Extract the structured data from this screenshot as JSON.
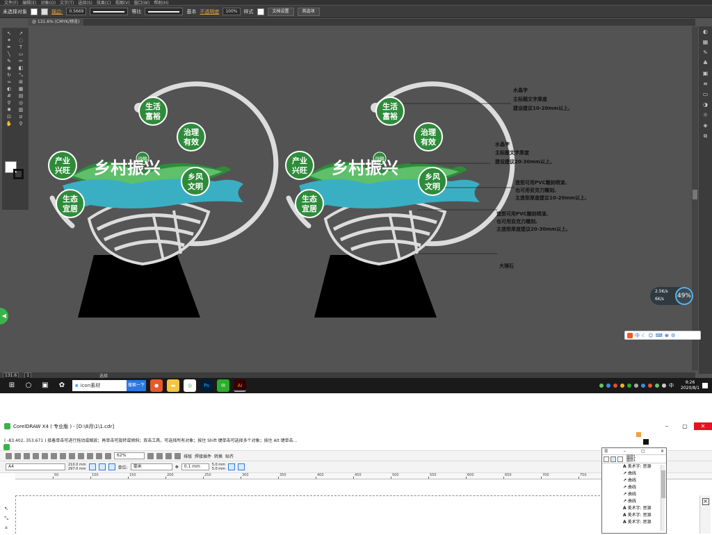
{
  "illustrator": {
    "menu": [
      "文件(F)",
      "编辑(E)",
      "对象(O)",
      "文字(T)",
      "选择(S)",
      "效果(C)",
      "视图(V)",
      "窗口(W)",
      "帮助(H)"
    ],
    "control": {
      "no_selection": "未选择对象",
      "stroke_label": "描边:",
      "stroke_width": "0.5669",
      "profile_uniform": "等比",
      "brush_basic": "基本",
      "opacity_label": "不透明度",
      "opacity_value": "100%",
      "style_label": "样式",
      "doc_setup": "文档设置",
      "preferences": "首选项"
    },
    "tab": "@ 131.6% (CMYK/预览)",
    "status": {
      "zoom": "131.6",
      "page": "1",
      "tool": "选择"
    },
    "network": {
      "up": "2.5K/s",
      "down": "6K/s",
      "percent": "49%"
    },
    "ime_label": "中"
  },
  "artwork": {
    "main_title": "乡村振兴",
    "badge_small": "战略",
    "badges": [
      "生活富裕",
      "治理有效",
      "产业兴旺",
      "乡风文明",
      "生态宜居"
    ],
    "annotations": [
      [
        "水晶字",
        "主标题文字厚度",
        "建设建议10-20mm以上,"
      ],
      [
        "水晶字",
        "主标题文字厚度",
        "建设建议20-30mm以上,"
      ],
      [
        "造型可用PVC雕刻喷漆,",
        "也可用亚克力雕刻,",
        "主造型厚度建议10-20mm以上,"
      ],
      [
        "造型可用PVC雕刻喷漆,",
        "也可用亚克力雕刻,",
        "主造型厚度建议20-30mm以上,"
      ],
      [
        "大理石"
      ]
    ],
    "colors": {
      "teal": "#3aafc4",
      "green": "#2e8b3a",
      "leaf": "#5fbf6a",
      "stone": "#000000",
      "ring": "#dcdcdc"
    }
  },
  "taskbar": {
    "search_text": "icon素材",
    "search_button": "搜索一下",
    "apps": [
      "Ps",
      "Ai"
    ],
    "time": "9:26",
    "date": "2020/8/1",
    "lang": "中"
  },
  "coreldraw": {
    "title": "CorelDRAW X4 ( 专业版 ) - [D:\\8月\\1\\1.cdr]",
    "hint": "( -83.402, 353.671 )    接着单击可进行拖动或缩放；再单击可旋转或倾斜；双击工具，可选择所有对象；按住 Shift 键单击可选择多个对象；按住 Alt 键单击...",
    "zoom": "62%",
    "toolbar_labels": [
      "排版",
      "焊接插件",
      "转换",
      "贴齐"
    ],
    "page_size": "A4",
    "width": "210.0 mm",
    "height": "297.0 mm",
    "units_label": "单位:",
    "units": "毫米",
    "nudge": "0.1 mm",
    "dup_x": "5.0 mm",
    "dup_y": "5.0 mm",
    "ruler_ticks": [
      "50",
      "100",
      "150",
      "200",
      "250",
      "300",
      "350",
      "400",
      "450",
      "500",
      "550",
      "600",
      "650",
      "700",
      "750",
      "800"
    ],
    "objmgr": {
      "layers": [
        "图层1",
        "图层1"
      ],
      "items": [
        {
          "icon": "A",
          "label": "美术字: 思源"
        },
        {
          "icon": "↗",
          "label": "曲线"
        },
        {
          "icon": "↗",
          "label": "曲线"
        },
        {
          "icon": "↗",
          "label": "曲线"
        },
        {
          "icon": "↗",
          "label": "曲线"
        },
        {
          "icon": "↗",
          "label": "曲线"
        },
        {
          "icon": "A",
          "label": "美术字: 思源"
        },
        {
          "icon": "A",
          "label": "美术字: 思源"
        },
        {
          "icon": "A",
          "label": "美术字: 思源"
        }
      ]
    }
  }
}
